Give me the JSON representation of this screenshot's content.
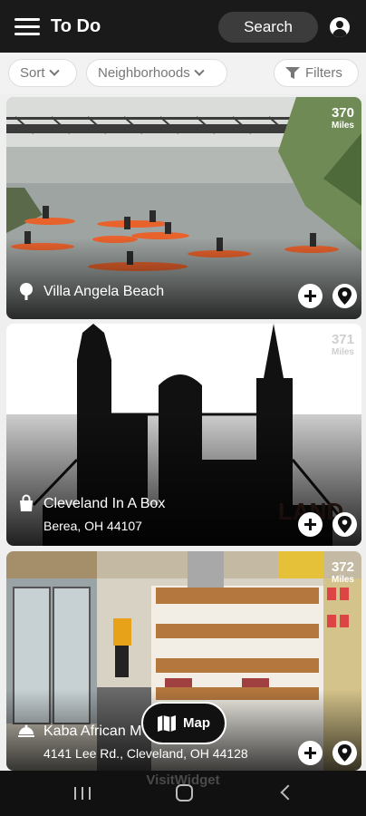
{
  "header": {
    "title": "To Do",
    "search_label": "Search",
    "menu_icon": "hamburger-icon",
    "account_icon": "account-icon"
  },
  "filters": {
    "sort_label": "Sort",
    "neighborhoods_label": "Neighborhoods",
    "filters_label": "Filters"
  },
  "listings": [
    {
      "name": "Villa Angela Beach",
      "address": "",
      "distance": "370",
      "distance_unit": "Miles",
      "category_icon": "tree-icon"
    },
    {
      "name": "Cleveland In A Box",
      "address": "Berea, OH 44107",
      "distance": "371",
      "distance_unit": "Miles",
      "category_icon": "shopping-bag-icon"
    },
    {
      "name": "Kaba African M",
      "address": "4141 Lee Rd., Cleveland, OH 44128",
      "distance": "372",
      "distance_unit": "Miles",
      "category_icon": "food-icon"
    }
  ],
  "map_button": {
    "label": "Map"
  },
  "watermark": "VisitWidget",
  "colors": {
    "header_bg": "#1a1a1a",
    "search_bg": "#3c3c3c",
    "navbar_bg": "#111111",
    "kayak_orange": "#e8622c"
  }
}
